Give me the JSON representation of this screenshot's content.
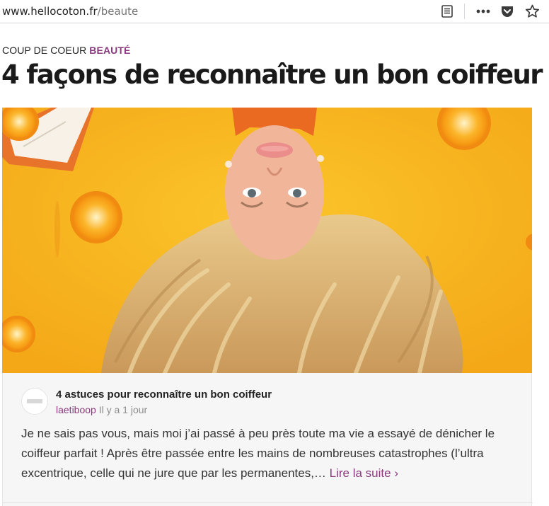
{
  "browser": {
    "url_domain": "www.hellocoton.fr",
    "url_path": "/beaute",
    "icons": [
      "reader-view-icon",
      "more-icon",
      "pocket-icon",
      "bookmark-star-icon"
    ]
  },
  "article": {
    "kicker_prefix": "COUP DE COEUR",
    "kicker_category": "BEAUTÉ",
    "headline": "4 façons de reconnaître un bon coiffeur"
  },
  "post": {
    "title": "4 astuces pour reconnaître un bon coiffeur",
    "author": "laetiboop",
    "time": "Il y a 1 jour",
    "excerpt": "Je ne sais pas vous, mais moi j’ai passé à peu près toute ma vie a essayé de dénicher le coiffeur parfait ! Après être passée entre les mains de nombreuses catastrophes (l’ultra excentrique, celle qui ne jure que par les permanentes,…",
    "read_more": "Lire la suite ›"
  },
  "colors": {
    "accent": "#8a3a7e",
    "hero_background": "#f7b51d",
    "card_background": "#f6f6f6"
  }
}
